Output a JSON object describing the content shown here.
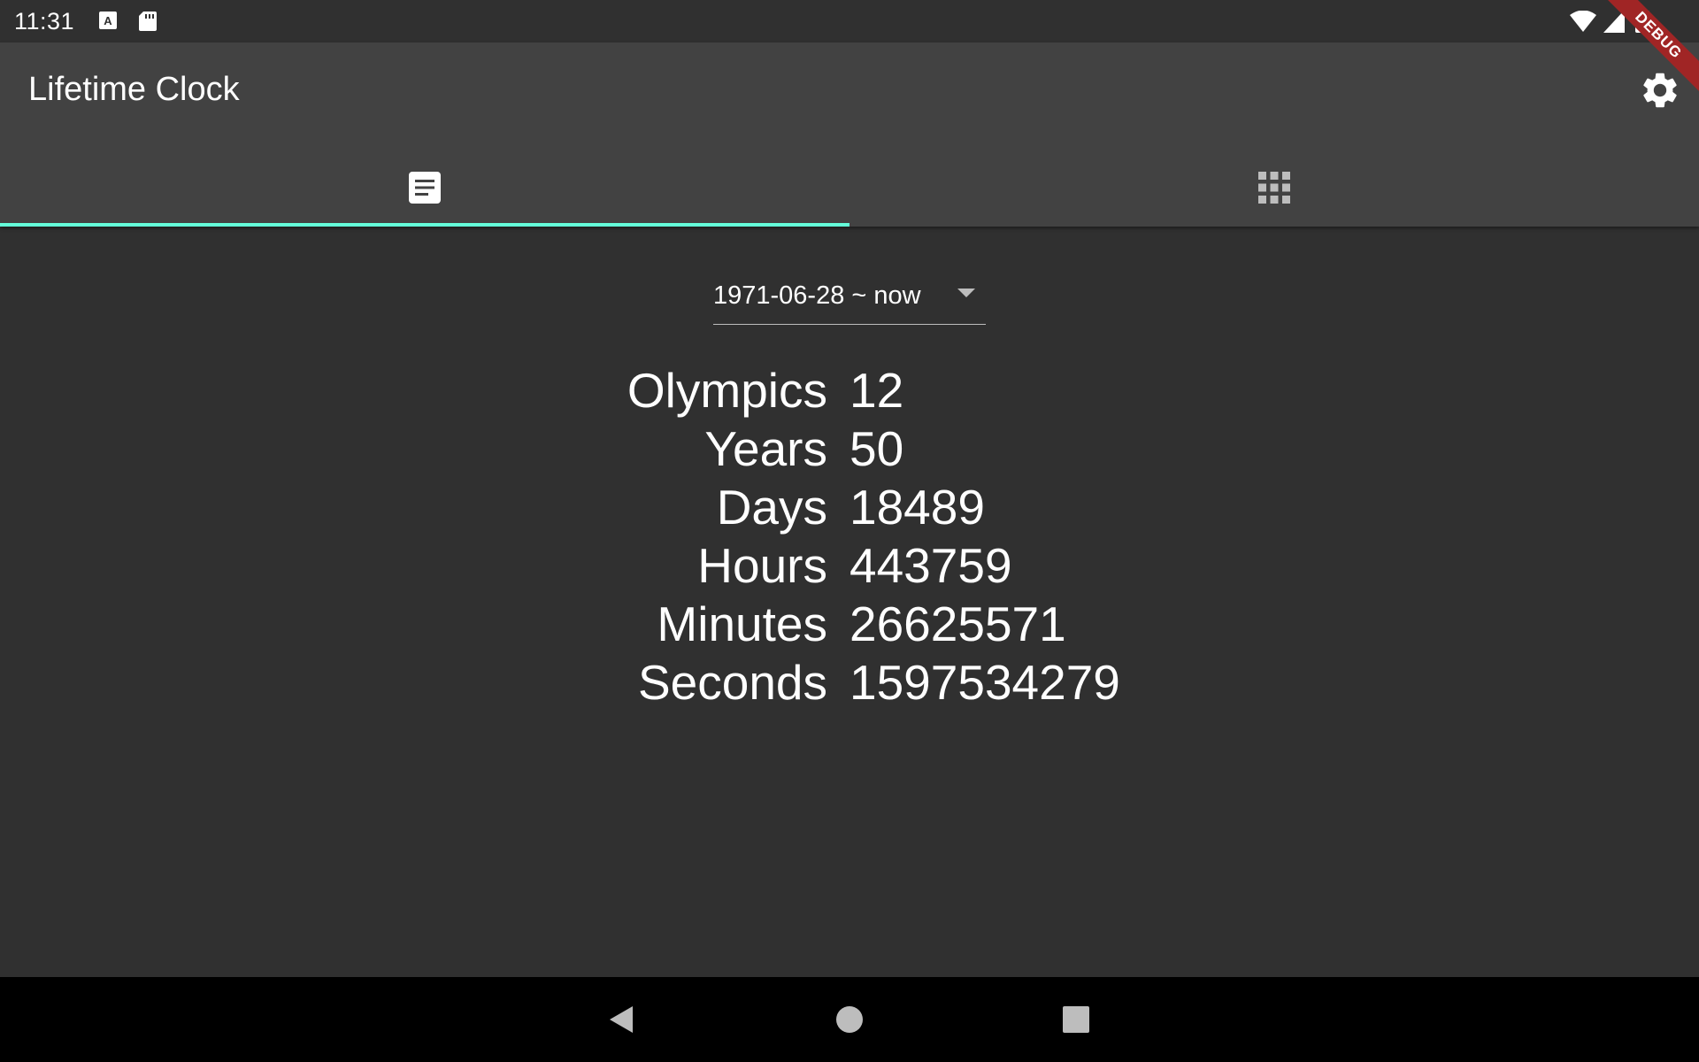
{
  "status_bar": {
    "time": "11:31",
    "icons": [
      "a-box-icon",
      "sd-card-icon",
      "wifi-icon",
      "cell-signal-icon",
      "battery-icon"
    ]
  },
  "app_bar": {
    "title": "Lifetime Clock",
    "settings_icon": "gear-icon",
    "accent_color": "#64ffda"
  },
  "tabs": [
    {
      "icon": "article-icon",
      "selected": true
    },
    {
      "icon": "apps-grid-icon",
      "selected": false
    }
  ],
  "debug_banner": "DEBUG",
  "range": {
    "selected": "1971-06-28 ~ now"
  },
  "stats": [
    {
      "label": "Olympics",
      "value": "12"
    },
    {
      "label": "Years",
      "value": "50"
    },
    {
      "label": "Days",
      "value": "18489"
    },
    {
      "label": "Hours",
      "value": "443759"
    },
    {
      "label": "Minutes",
      "value": "26625571"
    },
    {
      "label": "Seconds",
      "value": "1597534279"
    }
  ],
  "nav_bar": {
    "buttons": [
      "back-icon",
      "home-icon",
      "recents-icon"
    ]
  }
}
